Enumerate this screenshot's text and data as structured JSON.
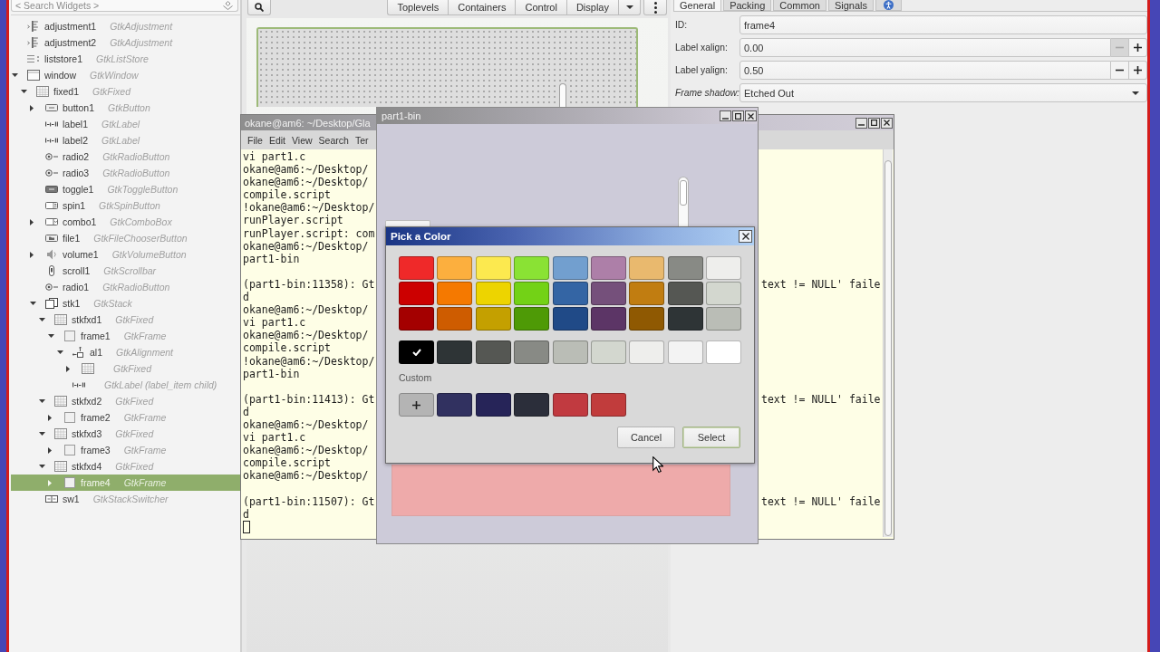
{
  "widget_search": {
    "placeholder": "< Search Widgets >"
  },
  "widget_tree": [
    {
      "name": "adjustment1",
      "type": "GtkAdjustment",
      "kind": "adjustment",
      "selected": false
    },
    {
      "name": "adjustment2",
      "type": "GtkAdjustment",
      "kind": "adjustment",
      "selected": false
    },
    {
      "name": "liststore1",
      "type": "GtkListStore",
      "kind": "liststore",
      "selected": false
    },
    {
      "name": "window",
      "type": "GtkWindow",
      "kind": "window",
      "selected": false,
      "expanded": true,
      "children": [
        {
          "name": "fixed1",
          "type": "GtkFixed",
          "kind": "fixed",
          "selected": false,
          "expanded": true,
          "children": [
            {
              "name": "button1",
              "type": "GtkButton",
              "kind": "button",
              "selected": false,
              "expanded": false
            },
            {
              "name": "label1",
              "type": "GtkLabel",
              "kind": "label",
              "selected": false
            },
            {
              "name": "label2",
              "type": "GtkLabel",
              "kind": "label",
              "selected": false
            },
            {
              "name": "radio2",
              "type": "GtkRadioButton",
              "kind": "radio",
              "selected": false
            },
            {
              "name": "radio3",
              "type": "GtkRadioButton",
              "kind": "radio",
              "selected": false
            },
            {
              "name": "toggle1",
              "type": "GtkToggleButton",
              "kind": "toggle",
              "selected": false
            },
            {
              "name": "spin1",
              "type": "GtkSpinButton",
              "kind": "spin",
              "selected": false
            },
            {
              "name": "combo1",
              "type": "GtkComboBox",
              "kind": "combo",
              "selected": false,
              "expanded": false
            },
            {
              "name": "file1",
              "type": "GtkFileChooserButton",
              "kind": "file",
              "selected": false
            },
            {
              "name": "volume1",
              "type": "GtkVolumeButton",
              "kind": "volume",
              "selected": false,
              "expanded": false
            },
            {
              "name": "scroll1",
              "type": "GtkScrollbar",
              "kind": "scrollbar",
              "selected": false
            },
            {
              "name": "radio1",
              "type": "GtkRadioButton",
              "kind": "radio",
              "selected": false
            },
            {
              "name": "stk1",
              "type": "GtkStack",
              "kind": "stack",
              "selected": false,
              "expanded": true,
              "children": [
                {
                  "name": "stkfxd1",
                  "type": "GtkFixed",
                  "kind": "fixed",
                  "selected": false,
                  "expanded": true,
                  "children": [
                    {
                      "name": "frame1",
                      "type": "GtkFrame",
                      "kind": "frame",
                      "selected": false,
                      "expanded": true,
                      "children": [
                        {
                          "name": "al1",
                          "type": "GtkAlignment",
                          "kind": "alignment",
                          "selected": false,
                          "expanded": true,
                          "children": [
                            {
                              "type": "GtkFixed",
                              "kind": "fixed",
                              "selected": false,
                              "expanded": false
                            }
                          ]
                        },
                        {
                          "type": "GtkLabel (label_item child)",
                          "kind": "label",
                          "selected": false
                        }
                      ]
                    }
                  ]
                },
                {
                  "name": "stkfxd2",
                  "type": "GtkFixed",
                  "kind": "fixed",
                  "selected": false,
                  "expanded": true,
                  "children": [
                    {
                      "name": "frame2",
                      "type": "GtkFrame",
                      "kind": "frame",
                      "selected": false,
                      "expanded": false
                    }
                  ]
                },
                {
                  "name": "stkfxd3",
                  "type": "GtkFixed",
                  "kind": "fixed",
                  "selected": false,
                  "expanded": true,
                  "children": [
                    {
                      "name": "frame3",
                      "type": "GtkFrame",
                      "kind": "frame",
                      "selected": false,
                      "expanded": false
                    }
                  ]
                },
                {
                  "name": "stkfxd4",
                  "type": "GtkFixed",
                  "kind": "fixed",
                  "selected": false,
                  "expanded": true,
                  "children": [
                    {
                      "name": "frame4",
                      "type": "GtkFrame",
                      "kind": "frame",
                      "selected": true,
                      "expanded": false
                    }
                  ]
                }
              ]
            },
            {
              "name": "sw1",
              "type": "GtkStackSwitcher",
              "kind": "stackswitcher",
              "selected": false
            }
          ]
        }
      ]
    }
  ],
  "toolbar": {
    "categories": [
      "Toplevels",
      "Containers",
      "Control",
      "Display"
    ]
  },
  "properties": {
    "tabs": [
      {
        "kind": "text",
        "label": "General",
        "selected": true
      },
      {
        "kind": "text",
        "label": "Packing",
        "selected": false
      },
      {
        "kind": "text",
        "label": "Common",
        "selected": false
      },
      {
        "kind": "text",
        "label": "Signals",
        "selected": false
      },
      {
        "kind": "icon",
        "selected": false
      }
    ],
    "rows": [
      {
        "kind": "entry",
        "label": "ID:",
        "value": "frame4",
        "italic": false
      },
      {
        "kind": "spin",
        "label": "Label xalign:",
        "value": "0.00",
        "italic": false,
        "decrement_disabled": true
      },
      {
        "kind": "spin",
        "label": "Label yalign:",
        "value": "0.50",
        "italic": false,
        "decrement_disabled": false
      },
      {
        "kind": "combo",
        "label": "Frame shadow:",
        "value": "Etched Out",
        "italic": true
      }
    ]
  },
  "terminal": {
    "title": "okane@am6: ~/Desktop/Gla",
    "menu": [
      "File",
      "Edit",
      "View",
      "Search",
      "Ter"
    ],
    "blocks": [
      [
        {
          "text": "vi part1.c"
        },
        {
          "text": "okane@am6:~/Desktop/"
        },
        {
          "text": "okane@am6:~/Desktop/"
        },
        {
          "text": "compile.script"
        },
        {
          "text": "!okane@am6:~/Desktop/"
        },
        {
          "text": "runPlayer.script"
        },
        {
          "text": "runPlayer.script: com"
        },
        {
          "text": "okane@am6:~/Desktop/"
        },
        {
          "text": "part1-bin"
        }
      ],
      [
        {
          "text": "(part1-bin:11358): Gt",
          "tail": "text != NULL' faile"
        },
        {
          "text": "d"
        },
        {
          "text": "okane@am6:~/Desktop/"
        },
        {
          "text": "vi part1.c"
        },
        {
          "text": "okane@am6:~/Desktop/"
        },
        {
          "text": "compile.script"
        },
        {
          "text": "!okane@am6:~/Desktop/"
        },
        {
          "text": "part1-bin"
        }
      ],
      [
        {
          "text": "(part1-bin:11413): Gt",
          "tail": "text != NULL' faile"
        },
        {
          "text": "d"
        },
        {
          "text": "okane@am6:~/Desktop/"
        },
        {
          "text": "vi part1.c"
        },
        {
          "text": "okane@am6:~/Desktop/"
        },
        {
          "text": "compile.script"
        },
        {
          "text": "okane@am6:~/Desktop/"
        }
      ],
      [
        {
          "text": "(part1-bin:11507): Gt",
          "tail": "text != NULL' faile"
        },
        {
          "text": "d"
        }
      ]
    ]
  },
  "app_window": {
    "title": "part1-bin"
  },
  "color_dialog": {
    "title": "Pick a Color",
    "palette": [
      [
        {
          "color": "#ef2929",
          "selected": false
        },
        {
          "color": "#fcaf3e",
          "selected": false
        },
        {
          "color": "#fce94f",
          "selected": false
        },
        {
          "color": "#8ae234",
          "selected": false
        },
        {
          "color": "#729fcf",
          "selected": false
        },
        {
          "color": "#ad7fa8",
          "selected": false
        },
        {
          "color": "#e9b96e",
          "selected": false
        },
        {
          "color": "#888a85",
          "selected": false
        },
        {
          "color": "#eeeeec",
          "selected": false
        }
      ],
      [
        {
          "color": "#cc0000",
          "selected": false
        },
        {
          "color": "#f57900",
          "selected": false
        },
        {
          "color": "#edd400",
          "selected": false
        },
        {
          "color": "#73d216",
          "selected": false
        },
        {
          "color": "#3465a4",
          "selected": false
        },
        {
          "color": "#75507b",
          "selected": false
        },
        {
          "color": "#c17d11",
          "selected": false
        },
        {
          "color": "#555753",
          "selected": false
        },
        {
          "color": "#d3d7cf",
          "selected": false
        }
      ],
      [
        {
          "color": "#a40000",
          "selected": false
        },
        {
          "color": "#ce5c00",
          "selected": false
        },
        {
          "color": "#c4a000",
          "selected": false
        },
        {
          "color": "#4e9a06",
          "selected": false
        },
        {
          "color": "#204a87",
          "selected": false
        },
        {
          "color": "#5c3566",
          "selected": false
        },
        {
          "color": "#8f5902",
          "selected": false
        },
        {
          "color": "#2e3436",
          "selected": false
        },
        {
          "color": "#babdb6",
          "selected": false
        }
      ]
    ],
    "grays": [
      {
        "color": "#000000",
        "selected": true
      },
      {
        "color": "#2e3436",
        "selected": false
      },
      {
        "color": "#555753",
        "selected": false
      },
      {
        "color": "#888a85",
        "selected": false
      },
      {
        "color": "#babdb6",
        "selected": false
      },
      {
        "color": "#d3d7cf",
        "selected": false
      },
      {
        "color": "#eeeeec",
        "selected": false
      },
      {
        "color": "#f3f3f3",
        "selected": false
      },
      {
        "color": "#ffffff",
        "selected": false
      }
    ],
    "custom_label": "Custom",
    "custom": [
      {
        "color": "#313160",
        "selected": false
      },
      {
        "color": "#262458",
        "selected": false
      },
      {
        "color": "#2b2e3a",
        "selected": false
      },
      {
        "color": "#c13a40",
        "selected": false
      },
      {
        "color": "#c13c3c",
        "selected": false
      }
    ],
    "buttons": [
      {
        "label": "Cancel",
        "default": false
      },
      {
        "label": "Select",
        "default": true
      }
    ]
  }
}
